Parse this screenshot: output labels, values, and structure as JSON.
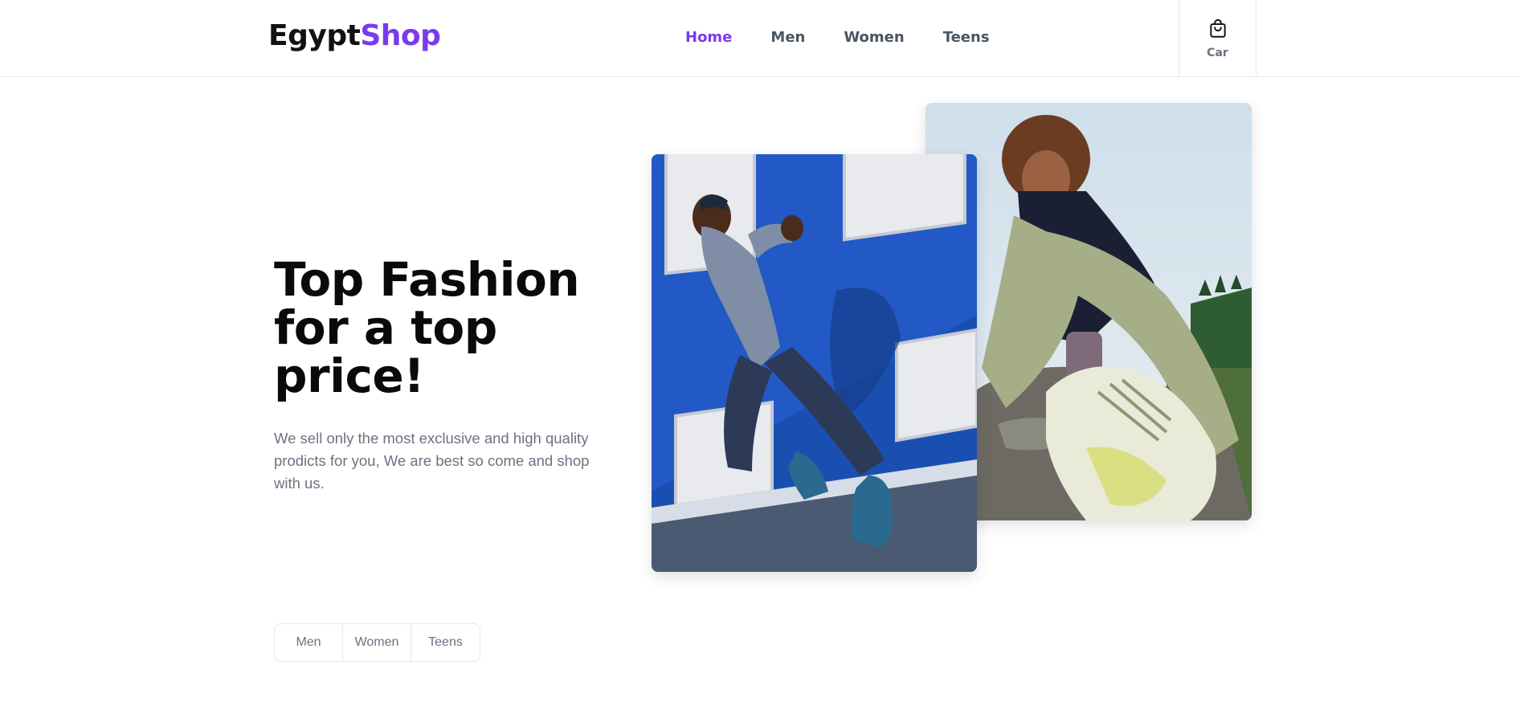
{
  "header": {
    "logo": {
      "part1": "Egypt",
      "part2": "Shop"
    },
    "nav": [
      {
        "label": "Home",
        "active": true
      },
      {
        "label": "Men",
        "active": false
      },
      {
        "label": "Women",
        "active": false
      },
      {
        "label": "Teens",
        "active": false
      }
    ],
    "cart": {
      "label": "Car",
      "icon": "shopping-bag-icon"
    }
  },
  "hero": {
    "title": "Top Fashion for a top price!",
    "subtitle": "We sell only the most exclusive and high quality prodicts for you, We are best so come and shop with us."
  },
  "images": [
    {
      "name": "runner-photo",
      "description_icon": "photo"
    },
    {
      "name": "sitting-sneaker-photo",
      "description_icon": "photo"
    }
  ],
  "tabs": [
    {
      "label": "Men"
    },
    {
      "label": "Women"
    },
    {
      "label": "Teens"
    }
  ],
  "colors": {
    "accent": "#7c3aed",
    "text_muted": "#6b7280",
    "border": "#e5e7eb"
  }
}
